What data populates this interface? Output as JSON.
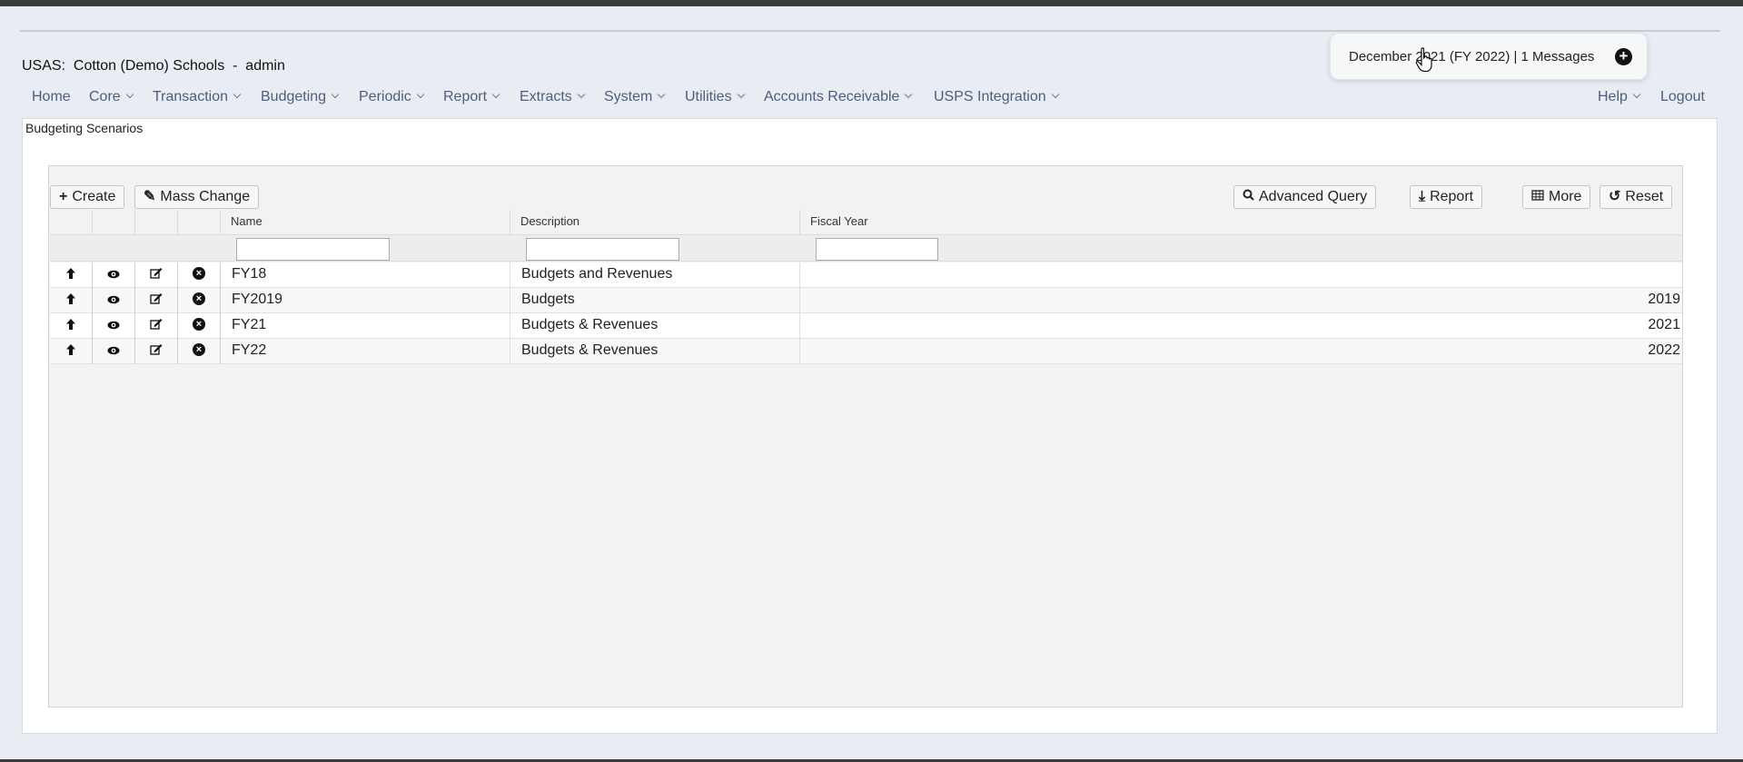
{
  "app": {
    "title": "USAS:  Cotton (Demo) Schools  -  admin"
  },
  "notification": {
    "text": "December 2021 (FY 2022) | 1 Messages",
    "add_icon": "plus-circle-icon"
  },
  "menu": {
    "items": [
      {
        "label": "Home",
        "dropdown": false
      },
      {
        "label": "Core",
        "dropdown": true
      },
      {
        "label": "Transaction",
        "dropdown": true
      },
      {
        "label": "Budgeting",
        "dropdown": true
      },
      {
        "label": "Periodic",
        "dropdown": true
      },
      {
        "label": "Report",
        "dropdown": true
      },
      {
        "label": "Extracts",
        "dropdown": true
      },
      {
        "label": "System",
        "dropdown": true
      },
      {
        "label": "Utilities",
        "dropdown": true
      },
      {
        "label": "Accounts Receivable",
        "dropdown": true
      },
      {
        "label": "USPS Integration",
        "dropdown": true
      }
    ],
    "right": [
      {
        "label": "Help",
        "dropdown": true
      },
      {
        "label": "Logout",
        "dropdown": false
      }
    ]
  },
  "page": {
    "title": "Budgeting Scenarios"
  },
  "toolbar": {
    "create": "Create",
    "mass_change": "Mass Change",
    "advanced_query": "Advanced Query",
    "report": "Report",
    "more": "More",
    "reset": "Reset"
  },
  "table": {
    "columns": [
      "Name",
      "Description",
      "Fiscal Year"
    ],
    "filters": {
      "name": "",
      "description": "",
      "fiscal_year": ""
    },
    "rows": [
      {
        "name": "FY18",
        "description": "Budgets and Revenues",
        "fiscal_year": ""
      },
      {
        "name": "FY2019",
        "description": "Budgets",
        "fiscal_year": "2019"
      },
      {
        "name": "FY21",
        "description": "Budgets & Revenues",
        "fiscal_year": "2021"
      },
      {
        "name": "FY22",
        "description": "Budgets & Revenues",
        "fiscal_year": "2022"
      }
    ],
    "row_actions": [
      "arrow-up-icon",
      "eye-icon",
      "edit-icon",
      "delete-circle-icon"
    ]
  }
}
